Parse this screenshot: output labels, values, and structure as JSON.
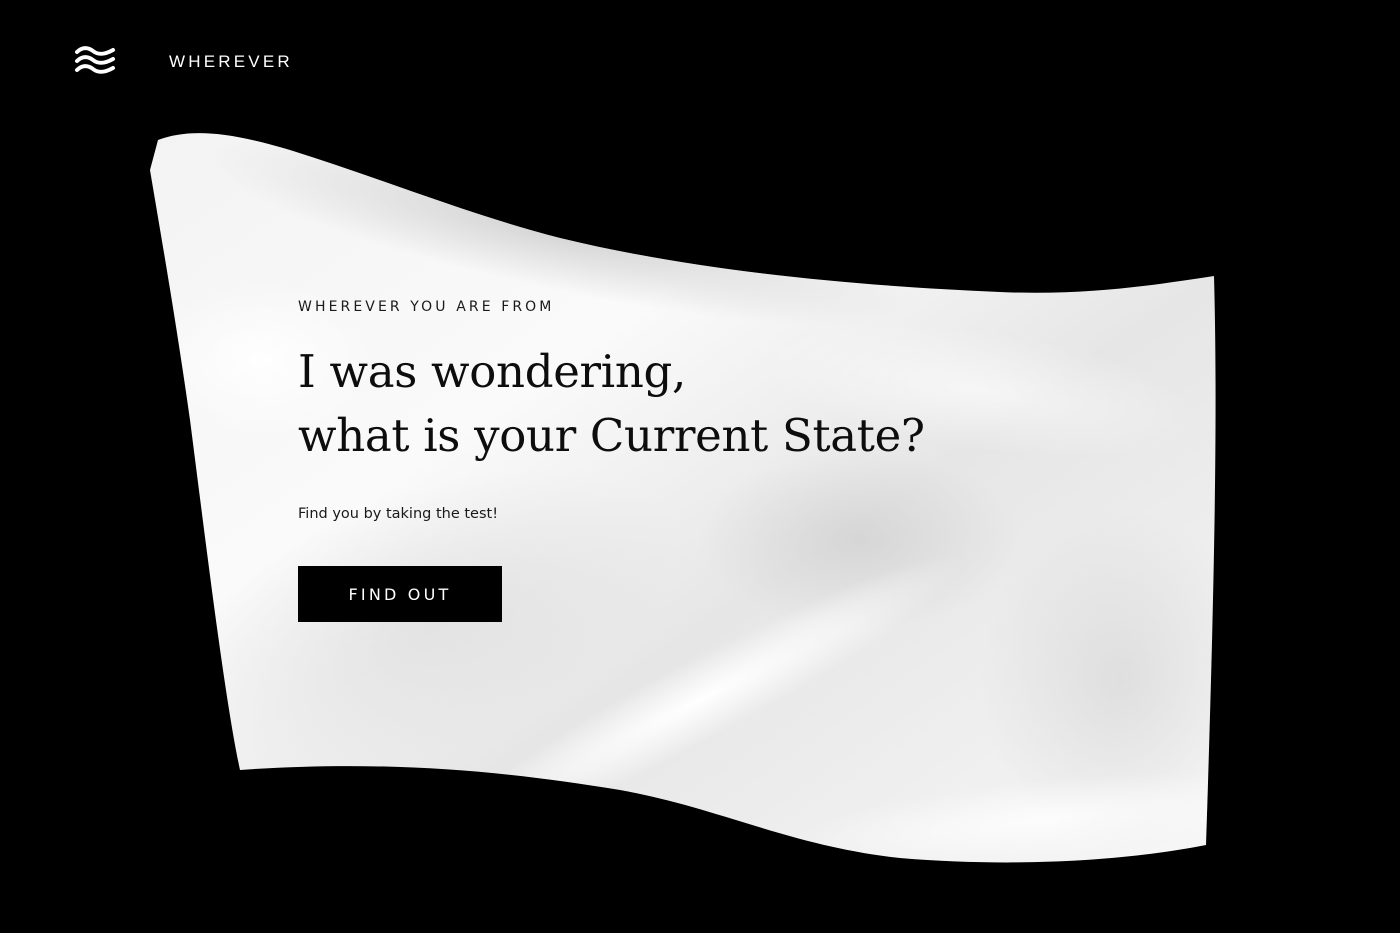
{
  "header": {
    "logo_icon": "wave-flag-icon",
    "brand": "WHEREVER"
  },
  "hero": {
    "eyebrow": "WHEREVER YOU ARE FROM",
    "headline_line1": "I was wondering,",
    "headline_line2": "what is your Current State?",
    "subtext": "Find you by taking the test!",
    "cta_label": "FIND OUT"
  },
  "colors": {
    "background": "#000000",
    "flag": "#f4f4f4",
    "text": "#111111",
    "button_bg": "#000000",
    "button_text": "#ffffff"
  }
}
